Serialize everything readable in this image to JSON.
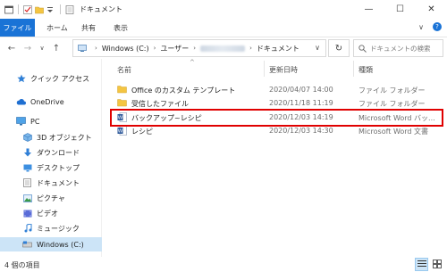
{
  "window": {
    "title": "ドキュメント",
    "minimize": "—",
    "maximize": "☐",
    "close": "✕"
  },
  "ribbon": {
    "file": "ファイル",
    "tabs": [
      "ホーム",
      "共有",
      "表示"
    ],
    "collapse": "∨",
    "help": "?"
  },
  "address": {
    "back": "←",
    "forward": "→",
    "recent": "∨",
    "up": "↑",
    "path": [
      "Windows (C:)",
      "ユーザー",
      "ドキュメント"
    ],
    "dropdown": "∨",
    "refresh": "↻"
  },
  "search": {
    "placeholder": "ドキュメントの検索",
    "icon": "magnifier"
  },
  "sidebar": {
    "items": [
      {
        "label": "クイック アクセス",
        "icon": "star"
      },
      {
        "label": "OneDrive",
        "icon": "cloud"
      },
      {
        "label": "PC",
        "icon": "monitor"
      },
      {
        "label": "3D オブジェクト",
        "icon": "cube"
      },
      {
        "label": "ダウンロード",
        "icon": "download"
      },
      {
        "label": "デスクトップ",
        "icon": "desktop"
      },
      {
        "label": "ドキュメント",
        "icon": "document"
      },
      {
        "label": "ピクチャ",
        "icon": "picture"
      },
      {
        "label": "ビデオ",
        "icon": "video"
      },
      {
        "label": "ミュージック",
        "icon": "music"
      },
      {
        "label": "Windows (C:)",
        "icon": "drive"
      }
    ]
  },
  "columns": {
    "name": "名前",
    "date": "更新日時",
    "type": "種類"
  },
  "files": [
    {
      "name": "Office のカスタム テンプレート",
      "date": "2020/04/07 14:00",
      "type": "ファイル フォルダー",
      "icon": "folder"
    },
    {
      "name": "受信したファイル",
      "date": "2020/11/18 11:19",
      "type": "ファイル フォルダー",
      "icon": "folder"
    },
    {
      "name": "バックアップ~レシピ",
      "date": "2020/12/03 14:19",
      "type": "Microsoft Word バッ...",
      "icon": "word-doc"
    },
    {
      "name": "レシピ",
      "date": "2020/12/03 14:30",
      "type": "Microsoft Word 文書",
      "icon": "word-doc"
    }
  ],
  "status": {
    "count": "4 個の項目"
  },
  "colors": {
    "file_tab": "#1a73d6",
    "selected": "#cce4f7",
    "highlight_border": "#e00000",
    "folder": "#f4c542"
  }
}
